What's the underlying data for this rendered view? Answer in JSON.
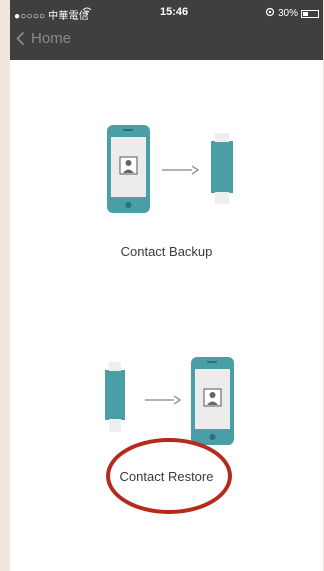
{
  "status_bar": {
    "carrier": "●○○○○ 中華電信",
    "wifi_icon": "wifi-icon",
    "time": "15:46",
    "battery_percent": "30%"
  },
  "nav": {
    "back_label": "Home"
  },
  "actions": [
    {
      "label": "Contact Backup"
    },
    {
      "label": "Contact Restore"
    }
  ],
  "colors": {
    "status_bar_bg": "#3f3f3f",
    "teal": "#4a9ea6",
    "annotation_red": "#b52a1c"
  }
}
